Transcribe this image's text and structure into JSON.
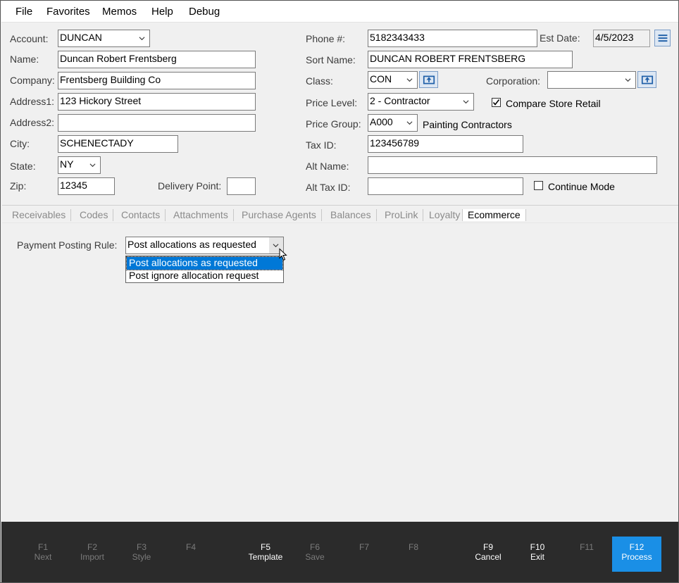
{
  "menu": [
    "File",
    "Favorites",
    "Memos",
    "Help",
    "Debug"
  ],
  "form": {
    "account": {
      "label": "Account:",
      "value": "DUNCAN"
    },
    "name": {
      "label": "Name:",
      "value": "Duncan Robert Frentsberg"
    },
    "company": {
      "label": "Company:",
      "value": "Frentsberg Building Co"
    },
    "address1": {
      "label": "Address1:",
      "value": "123 Hickory Street"
    },
    "address2": {
      "label": "Address2:",
      "value": ""
    },
    "city": {
      "label": "City:",
      "value": "SCHENECTADY"
    },
    "state": {
      "label": "State:",
      "value": "NY"
    },
    "zip": {
      "label": "Zip:",
      "value": "12345"
    },
    "delivery_point": {
      "label": "Delivery Point:",
      "value": ""
    },
    "phone": {
      "label": "Phone #:",
      "value": "5182343433"
    },
    "est_date": {
      "label": "Est Date:",
      "value": "4/5/2023"
    },
    "sort_name": {
      "label": "Sort Name:",
      "value": "DUNCAN ROBERT FRENTSBERG"
    },
    "class": {
      "label": "Class:",
      "value": "CON"
    },
    "corporation": {
      "label": "Corporation:",
      "value": ""
    },
    "price_level": {
      "label": "Price Level:",
      "value": "2 - Contractor"
    },
    "compare_store_retail": {
      "label": "Compare Store Retail",
      "checked": true
    },
    "price_group": {
      "label": "Price Group:",
      "value": "A000",
      "description": "Painting Contractors"
    },
    "tax_id": {
      "label": "Tax ID:",
      "value": "123456789"
    },
    "alt_name": {
      "label": "Alt  Name:",
      "value": ""
    },
    "alt_tax_id": {
      "label": "Alt Tax ID:",
      "value": ""
    },
    "continue_mode": {
      "label": "Continue Mode",
      "checked": false
    }
  },
  "tabs": [
    "Receivables",
    "Codes",
    "Contacts",
    "Attachments",
    "Purchase Agents",
    "Balances",
    "ProLink",
    "Loyalty",
    "Ecommerce"
  ],
  "active_tab": "Ecommerce",
  "ecommerce": {
    "payment_posting_rule": {
      "label": "Payment Posting Rule:",
      "value": "Post allocations as requested",
      "options": [
        "Post allocations as requested",
        "Post ignore allocation request"
      ]
    }
  },
  "fkeys": [
    {
      "key": "F1",
      "label": "Next"
    },
    {
      "key": "F2",
      "label": "Import"
    },
    {
      "key": "F3",
      "label": "Style"
    },
    {
      "key": "F4",
      "label": ""
    },
    {
      "key": "F5",
      "label": "Template"
    },
    {
      "key": "F6",
      "label": "Save"
    },
    {
      "key": "F7",
      "label": ""
    },
    {
      "key": "F8",
      "label": ""
    },
    {
      "key": "F9",
      "label": "Cancel"
    },
    {
      "key": "F10",
      "label": "Exit"
    },
    {
      "key": "F11",
      "label": ""
    },
    {
      "key": "F12",
      "label": "Process"
    }
  ],
  "colors": {
    "accent": "#1a8fe6",
    "selection": "#0078d7",
    "fkey_bar": "#2b2b2b"
  }
}
